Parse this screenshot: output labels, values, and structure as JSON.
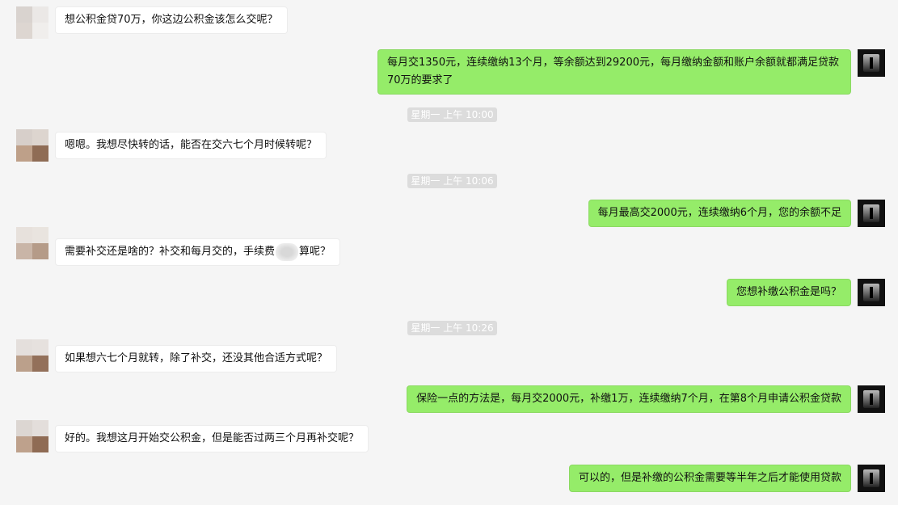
{
  "conversation": {
    "messages": [
      {
        "text": "想公积金贷70万，你这边公积金该怎么交呢？"
      },
      {
        "text": "每月交1350元，连续缴纳13个月，等余额达到29200元，每月缴纳金额和账户余额就都满足贷款70万的要求了"
      },
      {
        "time": "星期一 上午 10:00"
      },
      {
        "text": "嗯嗯。我想尽快转的话，能否在交六七个月时候转呢？"
      },
      {
        "time": "星期一 上午 10:06"
      },
      {
        "text": "每月最高交2000元，连续缴纳6个月，您的余额不足"
      },
      {
        "text_before": "需要补交还是啥的？补交和每月交的，手续费",
        "text_after": "算呢？"
      },
      {
        "text": "您想补缴公积金是吗？"
      },
      {
        "time": "星期一 上午 10:26"
      },
      {
        "text": "如果想六七个月就转，除了补交，还没其他合适方式呢？"
      },
      {
        "text": "保险一点的方法是，每月交2000元，补缴1万，连续缴纳7个月，在第8个月申请公积金贷款"
      },
      {
        "text": "好的。我想这月开始交公积金，但是能否过两三个月再补交呢？"
      },
      {
        "text": "可以的，但是补缴的公积金需要等半年之后才能使用贷款"
      }
    ]
  },
  "colors": {
    "background": "#f5f5f5",
    "incoming_bubble": "#ffffff",
    "outgoing_bubble": "#95ec69",
    "timestamp_bg": "#dcdcdc"
  },
  "icons": {
    "contact_avatar": "pixelated-avatar-icon",
    "self_avatar": "dark-portrait-avatar-icon"
  }
}
